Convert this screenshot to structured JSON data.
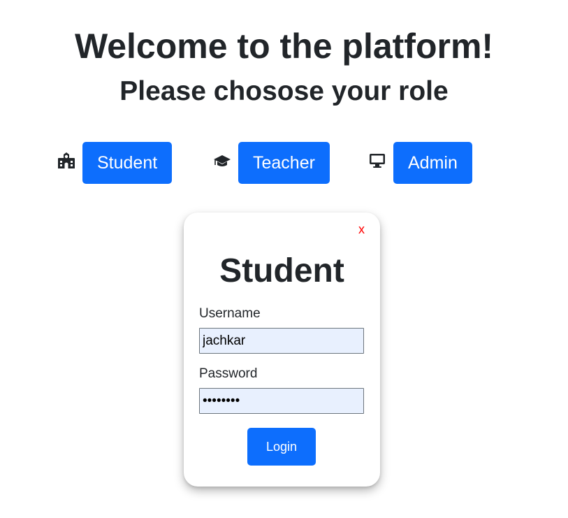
{
  "header": {
    "title": "Welcome to the platform!",
    "subtitle": "Please chosose your role"
  },
  "roles": [
    {
      "label": "Student",
      "icon": "school-icon"
    },
    {
      "label": "Teacher",
      "icon": "graduation-cap-icon"
    },
    {
      "label": "Admin",
      "icon": "desktop-icon"
    }
  ],
  "login_modal": {
    "close_label": "x",
    "title": "Student",
    "username_label": "Username",
    "username_value": "jachkar",
    "password_label": "Password",
    "password_value": "••••••••",
    "login_label": "Login"
  },
  "colors": {
    "primary": "#0d6efd",
    "close": "#ff0000",
    "input_bg": "#e8f0fe",
    "text": "#212529"
  }
}
